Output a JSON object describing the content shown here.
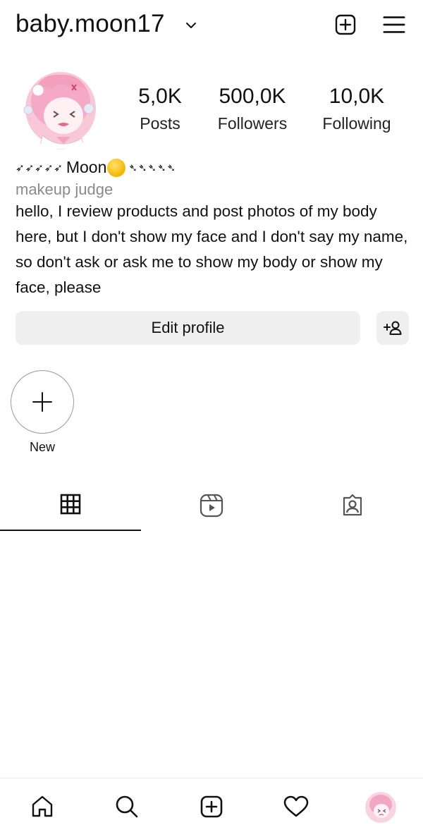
{
  "header": {
    "username": "baby.moon17",
    "icons": [
      "chevron-down-icon",
      "new-post-icon",
      "menu-icon"
    ]
  },
  "profile": {
    "avatar": "avatar",
    "stats": [
      {
        "value": "5,0K",
        "label": "Posts"
      },
      {
        "value": "500,0K",
        "label": "Followers"
      },
      {
        "value": "10,0K",
        "label": "Following"
      }
    ],
    "name_prefix": "➶➶➶➶➶",
    "name": "Moon",
    "name_emoji": "moon-emoji",
    "name_suffix": "➴➴➴➴➴",
    "category": "makeup judge",
    "bio": "hello, I review products and post photos of my body here, but I don't show my face and I don't say my name, so don't ask or ask me to show my body or show my face, please"
  },
  "actions": {
    "edit_profile_label": "Edit profile",
    "discover_people_icon": "add-person-icon"
  },
  "highlights": {
    "new_label": "New"
  },
  "tabs": [
    {
      "icon": "grid-icon",
      "selected": true
    },
    {
      "icon": "reels-icon",
      "selected": false
    },
    {
      "icon": "tagged-icon",
      "selected": false
    }
  ],
  "bottom_nav": {
    "icons": [
      "home-icon",
      "search-icon",
      "create-icon",
      "heart-icon",
      "profile-avatar"
    ]
  },
  "colors": {
    "button_bg": "#efefef",
    "secondary_text": "#8a8a8a",
    "text": "#111111"
  }
}
